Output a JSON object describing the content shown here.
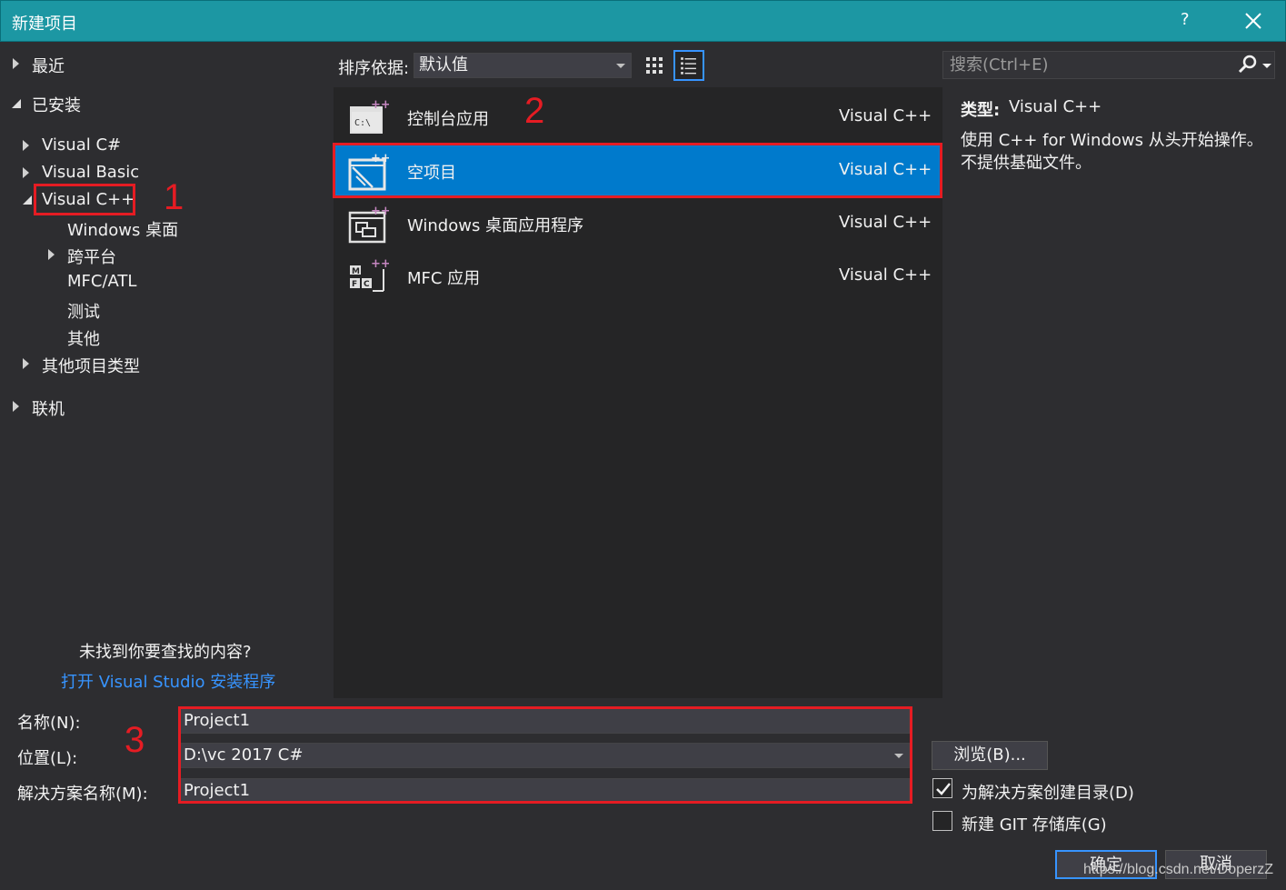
{
  "window": {
    "title": "新建项目",
    "help": "?"
  },
  "tree": {
    "recent": "最近",
    "installed": "已安装",
    "visual_csharp": "Visual C#",
    "visual_basic": "Visual Basic",
    "visual_cpp": "Visual C++",
    "windows_desktop": "Windows 桌面",
    "cross_platform": "跨平台",
    "mfc_atl": "MFC/ATL",
    "test": "测试",
    "other": "其他",
    "other_project_types": "其他项目类型",
    "online": "联机"
  },
  "not_found": {
    "text": "未找到你要查找的内容?",
    "link": "打开 Visual Studio 安装程序"
  },
  "sort": {
    "label": "排序依据:",
    "value": "默认值"
  },
  "templates": [
    {
      "name": "控制台应用",
      "lang": "Visual C++",
      "icon": "console-app-icon"
    },
    {
      "name": "空项目",
      "lang": "Visual C++",
      "icon": "empty-project-icon",
      "selected": true
    },
    {
      "name": "Windows 桌面应用程序",
      "lang": "Visual C++",
      "icon": "windows-desktop-app-icon"
    },
    {
      "name": "MFC 应用",
      "lang": "Visual C++",
      "icon": "mfc-app-icon"
    }
  ],
  "search": {
    "placeholder": "搜索(Ctrl+E)"
  },
  "details": {
    "type_label": "类型:",
    "type_value": "Visual C++",
    "desc_line1": "使用 C++ for Windows 从头开始操作。",
    "desc_line2": "不提供基础文件。"
  },
  "form": {
    "name_label": "名称(N):",
    "name_value": "Project1",
    "location_label": "位置(L):",
    "location_value": "D:\\vc 2017 C#",
    "solution_label": "解决方案名称(M):",
    "solution_value": "Project1",
    "browse": "浏览(B)...",
    "create_dir_label": "为解决方案创建目录(D)",
    "create_dir_checked": true,
    "git_label": "新建 GIT 存储库(G)",
    "git_checked": false,
    "ok": "确定",
    "cancel": "取消"
  },
  "annotations": {
    "n1": "1",
    "n2": "2",
    "n3": "3"
  },
  "watermark": "https://blog.csdn.net/DoperzZ",
  "colors": {
    "accent": "#1c97a3",
    "selection": "#007acc",
    "highlight": "#e51c23",
    "link": "#3794ff"
  }
}
